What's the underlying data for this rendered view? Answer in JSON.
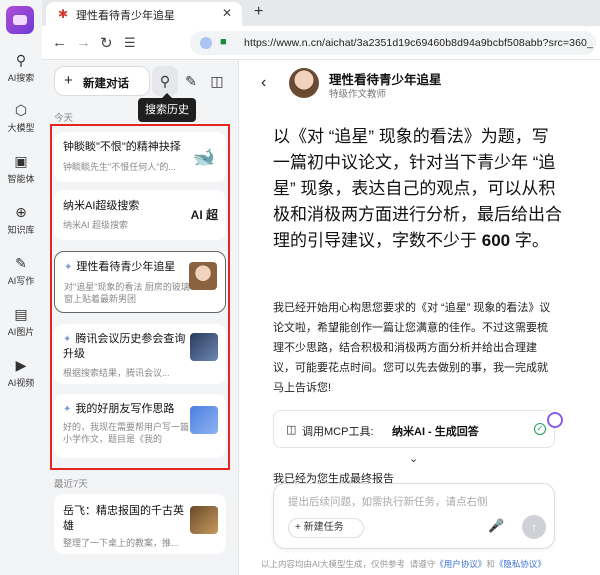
{
  "rail": {
    "items": [
      {
        "label": "AI搜索",
        "icon": "search-icon"
      },
      {
        "label": "大模型",
        "icon": "cube-icon"
      },
      {
        "label": "智能体",
        "icon": "robot-icon"
      },
      {
        "label": "知识库",
        "icon": "knowledge-icon"
      },
      {
        "label": "AI写作",
        "icon": "pen-icon"
      },
      {
        "label": "AI图片",
        "icon": "image-icon"
      },
      {
        "label": "AI视频",
        "icon": "video-icon"
      }
    ]
  },
  "browser": {
    "tab_title": "理性看待青少年追星",
    "url": "https://www.n.cn/aichat/3a2351d19c69460b8d94a9bcbf508abb?src=360_"
  },
  "sidebar": {
    "new_chat": "新建对话",
    "tooltip": "搜索历史",
    "section_today": "今天",
    "section_week": "最近7天",
    "items": [
      {
        "title": "钟睒睒\"不恨\"的精神抉择",
        "subtitle": "钟睒睒先生\"不恨任何人\"的..."
      },
      {
        "title": "纳米AI超级搜索",
        "subtitle": "纳米AI 超级搜索"
      },
      {
        "title": "理性看待青少年追星",
        "subtitle": "对\"追星\"现象的看法 厨房的玻璃窗上贴着最新男团"
      },
      {
        "title": "腾讯会议历史参会查询升级",
        "subtitle": "根据搜索结果，腾讯会议..."
      },
      {
        "title": "我的好朋友写作思路",
        "subtitle": "好的，我现在需要帮用户写一篇小学作文，题目是《我的"
      },
      {
        "title": "岳飞：精忠报国的千古英雄",
        "subtitle": "整理了一下桌上的教案，推..."
      }
    ],
    "thumb_text_1": "AI 超"
  },
  "main": {
    "bot_name": "理性看待青少年追星",
    "bot_subtitle": "特级作文教师",
    "prompt_a": "以《对 “追星” 现象的看法》为题，写一篇初中议论文，针对当下青少年 “追星” 现象，表达自己的观点，可以从积极和消极两方面进行分析，最后给出合理的引导建议，字数不少于 ",
    "prompt_b": "600",
    "prompt_c": " 字。",
    "reply": "我已经开始用心构思您要求的《对 “追星” 现象的看法》议论文啦，希望能创作一篇让您满意的佳作。不过这需要梳理不少思路，结合积极和消极两方面分析并给出合理建议，可能要花点时间。您可以先去做别的事，我一完成就马上告诉您!",
    "mcp_label": "调用MCP工具:",
    "mcp_value": "纳米AI - 生成回答",
    "partial_text": "我已经为您生成最终报告",
    "input_placeholder": "提出后续问题，如需执行新任务，请点右侧",
    "new_task": "+ 新建任务",
    "disclaimer_prefix": "以上内容均由AI大模型生成，仅供参考",
    "disclaimer_mid": "请遵守",
    "link_user": "《用户协议》",
    "disclaimer_and": "和",
    "link_privacy": "《隐私协议》"
  },
  "colors": {
    "highlight_border": "#e5261f",
    "accent_purple": "#8a5df0",
    "link_blue": "#3b6fd6"
  }
}
